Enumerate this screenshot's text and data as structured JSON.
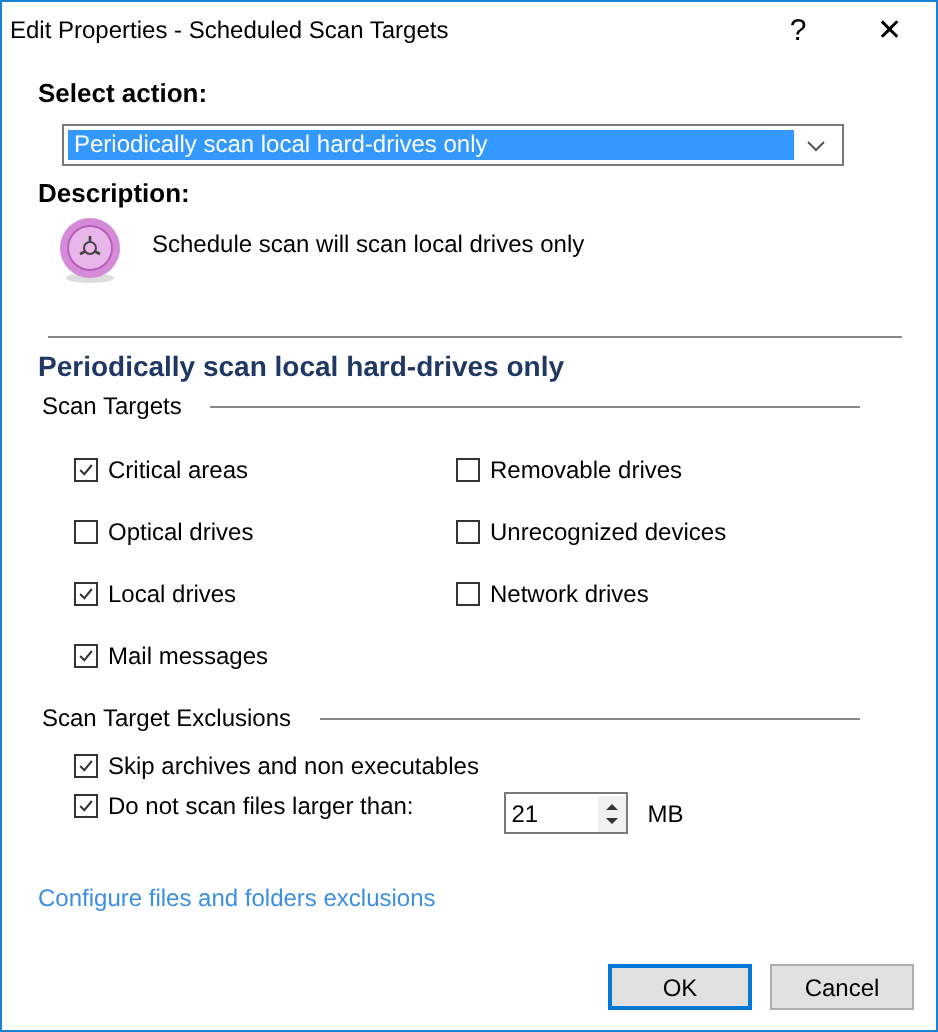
{
  "window": {
    "title": "Edit Properties - Scheduled Scan Targets",
    "help": "?",
    "close": "✕"
  },
  "select_action": {
    "label": "Select action:",
    "value": "Periodically scan local hard-drives only"
  },
  "description": {
    "label": "Description:",
    "text": "Schedule scan will scan local drives only"
  },
  "heading": "Periodically scan local hard-drives only",
  "scan_targets": {
    "title": "Scan Targets",
    "items": [
      {
        "label": "Critical areas",
        "checked": true
      },
      {
        "label": "Removable drives",
        "checked": false
      },
      {
        "label": "Optical drives",
        "checked": false
      },
      {
        "label": "Unrecognized devices",
        "checked": false
      },
      {
        "label": "Local drives",
        "checked": true
      },
      {
        "label": "Network drives",
        "checked": false
      },
      {
        "label": "Mail messages",
        "checked": true
      }
    ]
  },
  "exclusions": {
    "title": "Scan Target Exclusions",
    "items": [
      {
        "label": "Skip archives and non executables",
        "checked": true
      },
      {
        "label": "Do not scan files larger than:",
        "checked": true,
        "spinner": {
          "value": "21",
          "unit": "MB"
        }
      }
    ]
  },
  "link": "Configure files and folders exclusions",
  "buttons": [
    {
      "label": "OK",
      "default": true
    },
    {
      "label": "Cancel",
      "default": false
    }
  ]
}
